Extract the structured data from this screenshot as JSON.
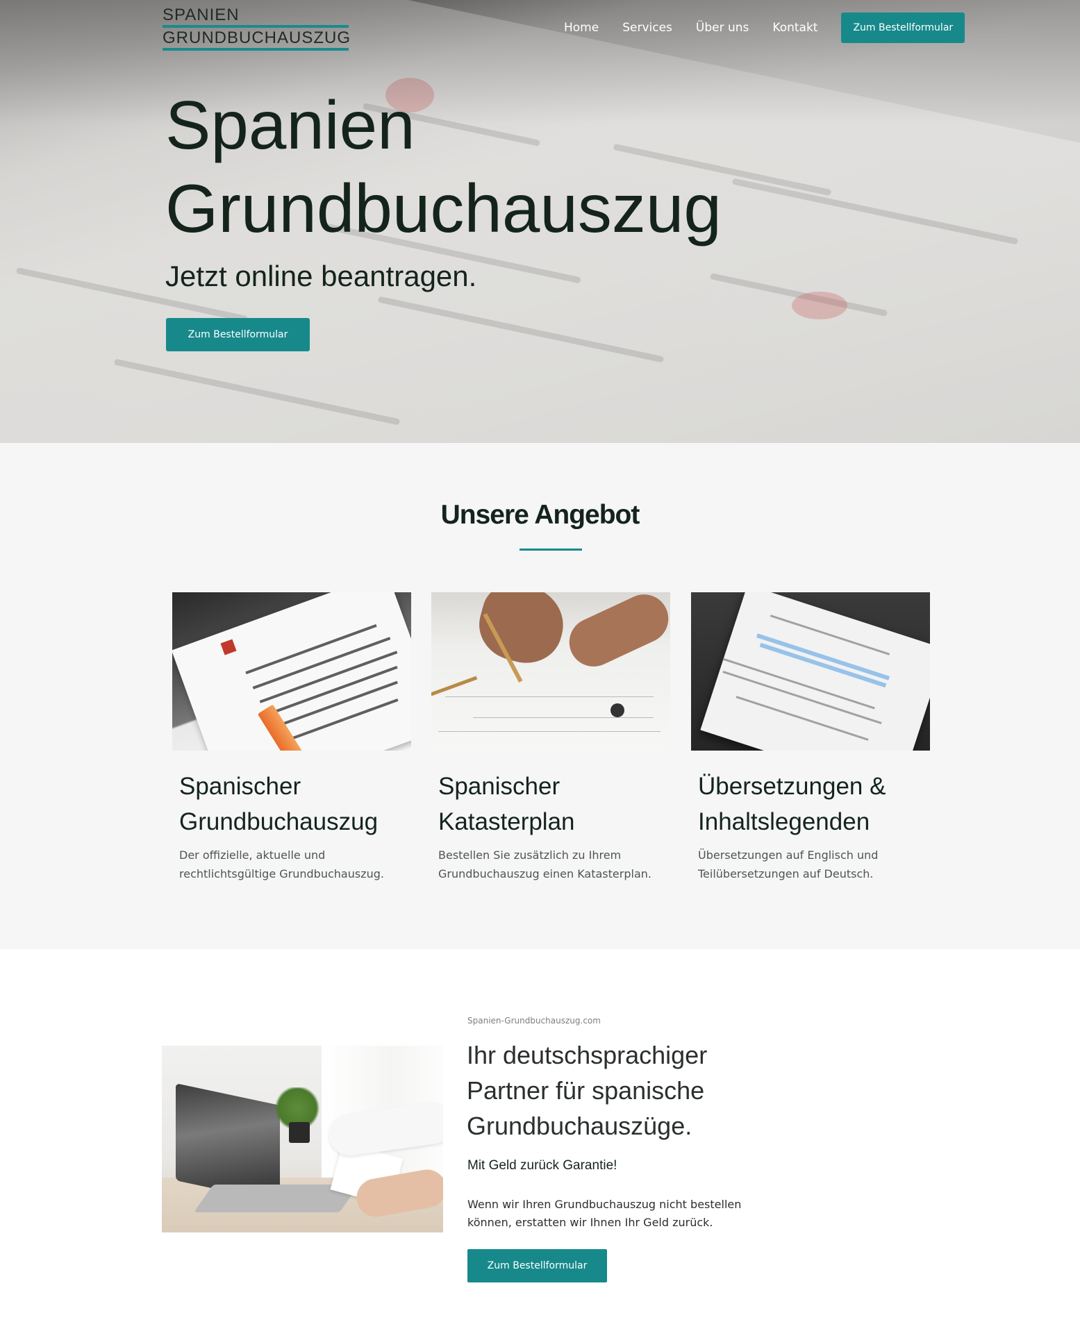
{
  "header": {
    "logo_line1": "SPANIEN",
    "logo_line2": "GRUNDBUCHAUSZUG",
    "nav": [
      {
        "label": "Home"
      },
      {
        "label": "Services"
      },
      {
        "label": "Über uns"
      },
      {
        "label": "Kontakt"
      }
    ],
    "cta_label": "Zum Bestellformular"
  },
  "hero": {
    "title": "Spanien Grundbuchauszug",
    "subtitle": "Jetzt online beantragen.",
    "button_label": "Zum Bestellformular"
  },
  "offers": {
    "title": "Unsere Angebot",
    "cards": [
      {
        "title": "Spanischer Grundbuchauszug",
        "text": "Der offizielle, aktuelle und rechtlichtsgültige Grundbuchauszug."
      },
      {
        "title": "Spanischer Katasterplan",
        "text": "Bestellen Sie zusätzlich zu Ihrem Grundbuchauszug einen Katasterplan."
      },
      {
        "title": "Übersetzungen & Inhaltslegenden",
        "text": "Übersetzungen auf Englisch und Teilübersetzungen auf Deutsch."
      }
    ]
  },
  "partner": {
    "domain": "Spanien-Grundbuchauszug.com",
    "title": "Ihr deutschsprachiger Partner für spanische Grundbuchauszüge.",
    "subtitle": "Mit Geld zurück Garantie!",
    "text": "Wenn wir Ihren Grundbuchauszug nicht bestellen können, erstatten wir Ihnen Ihr Geld zurück.",
    "button_label": "Zum Bestellformular"
  },
  "colors": {
    "accent": "#17898b",
    "heading": "#14241d",
    "section_bg": "#f6f6f6"
  }
}
